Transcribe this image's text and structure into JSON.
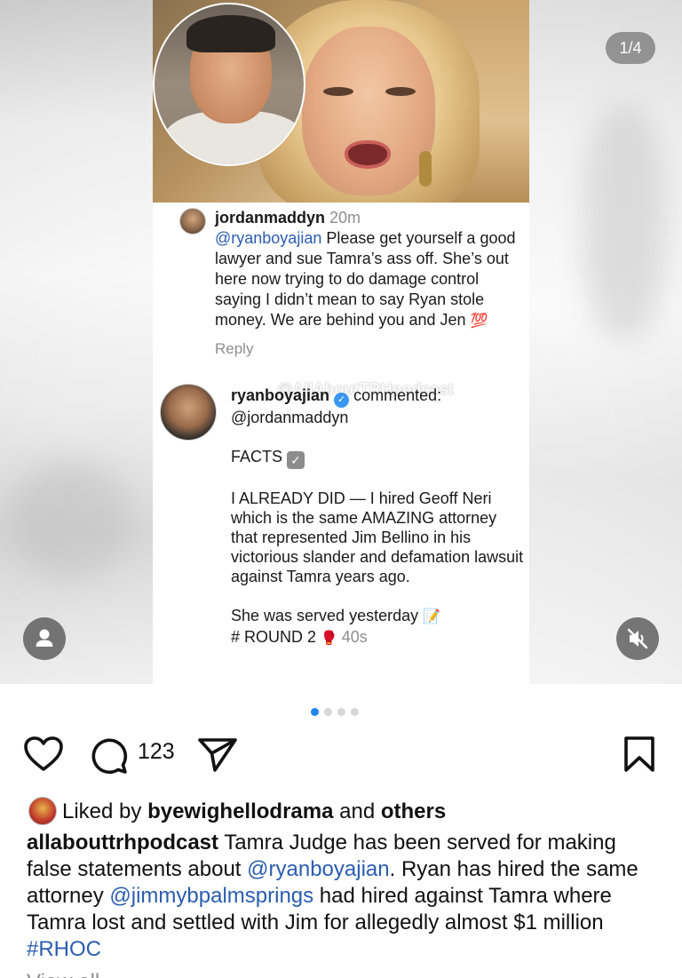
{
  "media": {
    "counter": "1/4",
    "comment1": {
      "username": "jordanmaddyn",
      "time": "20m",
      "mention": "@ryanboyajian",
      "text": " Please get yourself a good lawyer and sue Tamra’s ass off. She’s out here now trying to do damage control saying I didn’t mean to say Ryan stole money. We are behind you and Jen ",
      "emoji": "💯",
      "reply_label": "Reply"
    },
    "watermark": "@AllAboutTRHpodcast",
    "comment2": {
      "username": "ryanboyajian",
      "verb": "commented:",
      "mention": "@jordanmaddyn",
      "facts": "FACTS",
      "paragraph": "I ALREADY DID — I hired Geoff Neri which is the same AMAZING attorney that represented Jim Bellino in his victorious slander and defamation lawsuit against Tamra years ago.",
      "served": "She was served yesterday",
      "served_emoji": "📝",
      "round": "# ROUND 2",
      "round_emoji": "🥊",
      "time": "40s"
    },
    "carousel_total": 4,
    "carousel_active": 0
  },
  "actions": {
    "comment_count": "123"
  },
  "likes": {
    "prefix": "Liked by ",
    "user": "byewighellodrama",
    "and": " and ",
    "others": "others"
  },
  "caption": {
    "username": "allabouttrhpodcast",
    "text1": " Tamra Judge has been served for making false statements about ",
    "mention1": "@ryanboyajian",
    "text2": ". Ryan has hired the same attorney ",
    "mention2": "@jimmybpalmsprings",
    "text3": " had hired against Tamra where Tamra lost and settled with Jim for allegedly almost $1 million ",
    "hashtag": "#RHOC"
  },
  "view_more": "View all"
}
